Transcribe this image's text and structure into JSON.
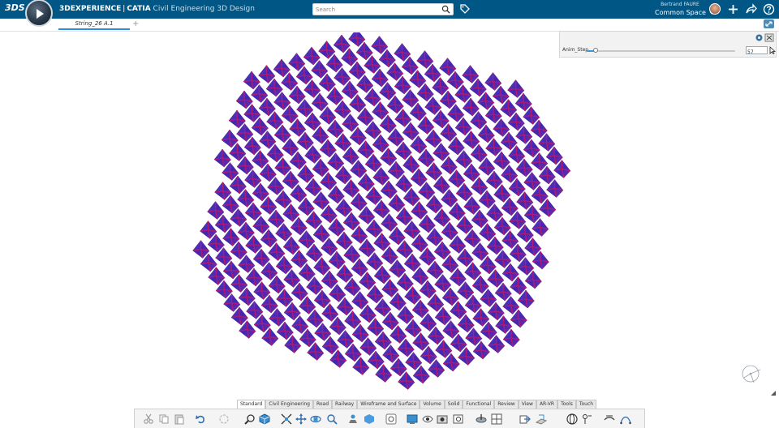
{
  "top_bar": {
    "ds_logo": "3DS",
    "brand_name": "3DEXPERIENCE",
    "separator": "|",
    "product": "CATIA",
    "app_name": "Civil Engineering 3D Design",
    "search_placeholder": "Search",
    "user_name": "Bertrand FAURE",
    "collaborative_space": "Common Space",
    "icons": [
      "compass-icon",
      "search-icon",
      "tag-icon",
      "avatar",
      "plus-icon",
      "share-icon",
      "help-icon"
    ]
  },
  "document_tab": {
    "label": "String_26 A.1",
    "add_label": "+"
  },
  "panel": {
    "parameter_label": "Anim_Step",
    "value": "57",
    "slider_fraction": 0.06
  },
  "bottom_tabs": [
    {
      "label": "Standard",
      "active": true
    },
    {
      "label": "Civil Engineering",
      "active": false
    },
    {
      "label": "Road",
      "active": false
    },
    {
      "label": "Railway",
      "active": false
    },
    {
      "label": "Wireframe and Surface",
      "active": false
    },
    {
      "label": "Volume",
      "active": false
    },
    {
      "label": "Solid",
      "active": false
    },
    {
      "label": "Functional",
      "active": false
    },
    {
      "label": "Review",
      "active": false
    },
    {
      "label": "View",
      "active": false
    },
    {
      "label": "AR-VR",
      "active": false
    },
    {
      "label": "Tools",
      "active": false
    },
    {
      "label": "Touch",
      "active": false
    }
  ],
  "colors": {
    "top_bar": "#005685",
    "accent": "#2f8fd0",
    "mesh_base": "#4b2fb8",
    "mesh_edge": "#c2186b"
  }
}
